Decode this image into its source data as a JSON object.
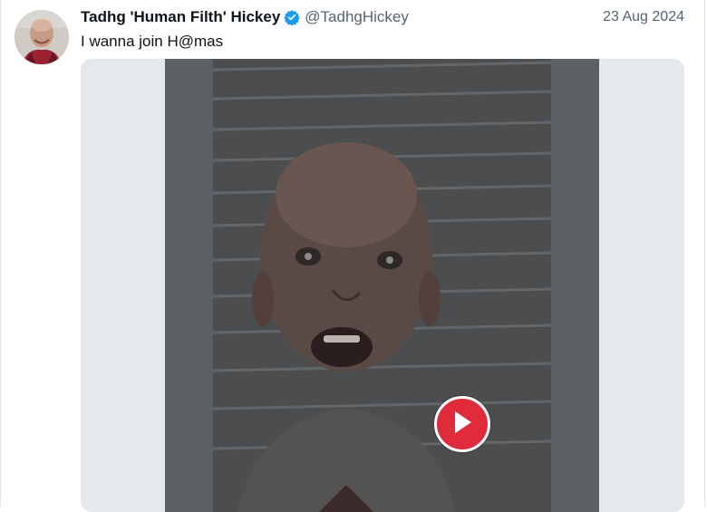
{
  "tweet": {
    "author": {
      "display_name": "Tadhg 'Human Filth' Hickey",
      "handle": "@TadhgHickey",
      "verified_icon": "verified-badge-icon"
    },
    "date": "23 Aug 2024",
    "text": "I wanna join H@mas",
    "media": {
      "type": "video",
      "play_icon": "play-icon"
    }
  },
  "colors": {
    "verified": "#1d9bf0",
    "play_button": "#e02b3c",
    "media_background": "#e4e9ee",
    "secondary_text": "#536471"
  }
}
